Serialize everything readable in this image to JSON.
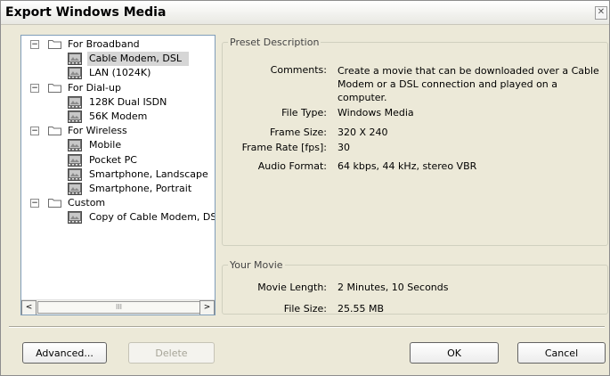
{
  "window": {
    "title": "Export Windows Media",
    "close_glyph": "✕"
  },
  "tree": {
    "items": [
      {
        "label": "For Broadband",
        "level": 0,
        "type": "folder",
        "expanded": true
      },
      {
        "label": "Cable Modem, DSL",
        "level": 1,
        "type": "preset",
        "selected": true
      },
      {
        "label": "LAN (1024K)",
        "level": 1,
        "type": "preset"
      },
      {
        "label": "For Dial-up",
        "level": 0,
        "type": "folder",
        "expanded": true
      },
      {
        "label": "128K Dual ISDN",
        "level": 1,
        "type": "preset"
      },
      {
        "label": "56K Modem",
        "level": 1,
        "type": "preset"
      },
      {
        "label": "For Wireless",
        "level": 0,
        "type": "folder",
        "expanded": true
      },
      {
        "label": "Mobile",
        "level": 1,
        "type": "preset"
      },
      {
        "label": "Pocket PC",
        "level": 1,
        "type": "preset"
      },
      {
        "label": "Smartphone, Landscape",
        "level": 1,
        "type": "preset"
      },
      {
        "label": "Smartphone, Portrait",
        "level": 1,
        "type": "preset"
      },
      {
        "label": "Custom",
        "level": 0,
        "type": "folder",
        "expanded": true
      },
      {
        "label": "Copy of Cable Modem, DS",
        "level": 1,
        "type": "preset"
      }
    ],
    "scroll": {
      "left_arrow": "<",
      "right_arrow": ">",
      "thumb_grip": "III"
    }
  },
  "preset": {
    "legend": "Preset Description",
    "comments_label": "Comments:",
    "comments_value": "Create a movie that can be downloaded over a Cable Modem or a DSL connection and played on a computer.",
    "file_type_label": "File Type:",
    "file_type_value": "Windows Media",
    "frame_size_label": "Frame Size:",
    "frame_size_value": "320 X 240",
    "frame_rate_label": "Frame Rate [fps]:",
    "frame_rate_value": "30",
    "audio_format_label": "Audio Format:",
    "audio_format_value": "64 kbps, 44 kHz, stereo VBR"
  },
  "movie": {
    "legend": "Your Movie",
    "length_label": "Movie Length:",
    "length_value": "2 Minutes, 10 Seconds",
    "size_label": "File Size:",
    "size_value": "25.55 MB"
  },
  "buttons": {
    "advanced": "Advanced...",
    "delete": "Delete",
    "ok": "OK",
    "cancel": "Cancel"
  }
}
